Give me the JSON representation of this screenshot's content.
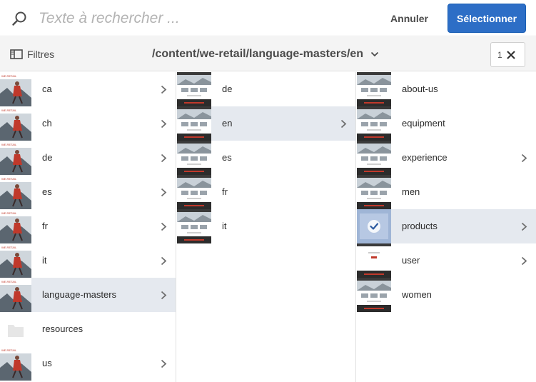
{
  "search": {
    "placeholder": "Texte à rechercher ...",
    "value": ""
  },
  "actions": {
    "cancel_label": "Annuler",
    "select_label": "Sélectionner"
  },
  "toolbar": {
    "filters_label": "Filtres",
    "path": "/content/we-retail/language-masters/en",
    "selection_count": "1"
  },
  "columns": [
    {
      "items": [
        {
          "label": "ca",
          "thumb": "person-photo",
          "has_children": true,
          "active": false
        },
        {
          "label": "ch",
          "thumb": "person-photo",
          "has_children": true,
          "active": false
        },
        {
          "label": "de",
          "thumb": "person-photo",
          "has_children": true,
          "active": false
        },
        {
          "label": "es",
          "thumb": "person-photo",
          "has_children": true,
          "active": false
        },
        {
          "label": "fr",
          "thumb": "person-photo",
          "has_children": true,
          "active": false
        },
        {
          "label": "it",
          "thumb": "person-photo",
          "has_children": true,
          "active": false
        },
        {
          "label": "language-masters",
          "thumb": "person-photo",
          "has_children": true,
          "active": true
        },
        {
          "label": "resources",
          "thumb": "folder-icon",
          "has_children": false,
          "active": false
        },
        {
          "label": "us",
          "thumb": "person-photo",
          "has_children": true,
          "active": false
        }
      ]
    },
    {
      "items": [
        {
          "label": "de",
          "thumb": "page-thumbnail",
          "has_children": false,
          "active": false
        },
        {
          "label": "en",
          "thumb": "page-thumbnail",
          "has_children": true,
          "active": true
        },
        {
          "label": "es",
          "thumb": "page-thumbnail",
          "has_children": false,
          "active": false
        },
        {
          "label": "fr",
          "thumb": "page-thumbnail",
          "has_children": false,
          "active": false
        },
        {
          "label": "it",
          "thumb": "page-thumbnail",
          "has_children": false,
          "active": false
        }
      ]
    },
    {
      "items": [
        {
          "label": "about-us",
          "thumb": "page-thumbnail",
          "has_children": false,
          "active": false
        },
        {
          "label": "equipment",
          "thumb": "page-thumbnail",
          "has_children": false,
          "active": false
        },
        {
          "label": "experience",
          "thumb": "page-thumbnail",
          "has_children": true,
          "active": false
        },
        {
          "label": "men",
          "thumb": "page-thumbnail",
          "has_children": false,
          "active": false
        },
        {
          "label": "products",
          "thumb": "selected-check-thumbnail",
          "has_children": true,
          "active": true
        },
        {
          "label": "user",
          "thumb": "user-page-thumbnail",
          "has_children": true,
          "active": false
        },
        {
          "label": "women",
          "thumb": "page-thumbnail",
          "has_children": false,
          "active": false
        }
      ]
    }
  ],
  "colors": {
    "accent": "#2d6ec6",
    "active_row": "#e5e9ef",
    "toolbar_bg": "#f4f4f4"
  }
}
